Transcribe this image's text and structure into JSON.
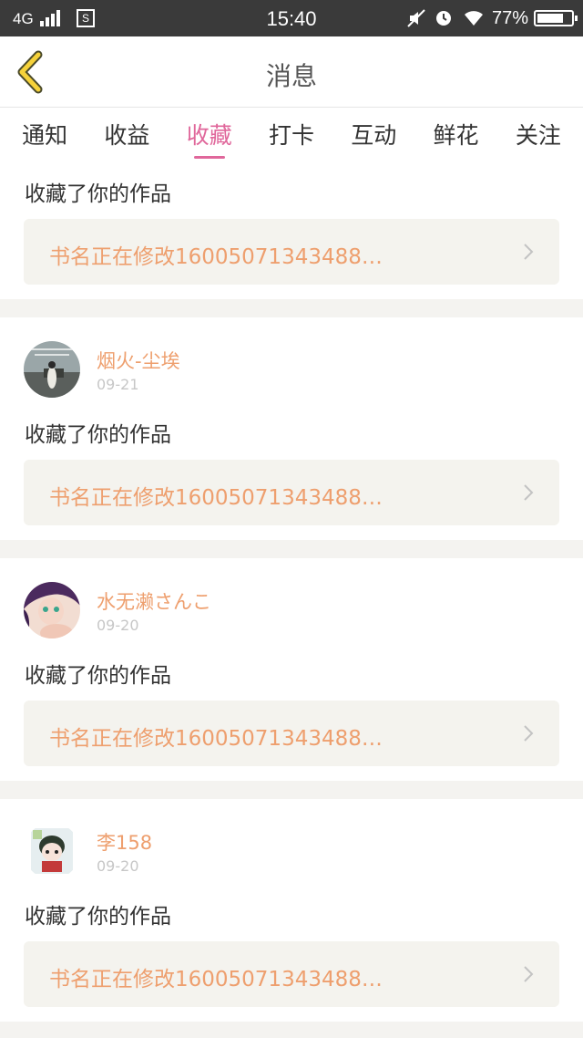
{
  "status_bar": {
    "network": "4G",
    "time": "15:40",
    "battery": "77%",
    "battery_level": 0.77,
    "icons": [
      "signal-icon",
      "sim-icon",
      "mute-icon",
      "alarm-icon",
      "wifi-icon",
      "battery-icon"
    ]
  },
  "header": {
    "title": "消息",
    "back_icon": "chevron-left-icon"
  },
  "colors": {
    "accent": "#e0679b",
    "name_orange": "#ee9f6e",
    "back_yellow": "#f6d23a"
  },
  "tabs": [
    {
      "label": "通知"
    },
    {
      "label": "收益"
    },
    {
      "label": "收藏",
      "active": true
    },
    {
      "label": "打卡"
    },
    {
      "label": "互动"
    },
    {
      "label": "鲜花"
    },
    {
      "label": "关注"
    }
  ],
  "messages": [
    {
      "user": "",
      "date": "",
      "action": "收藏了你的作品",
      "work_title": "书名正在修改16005071343488…"
    },
    {
      "user": "烟火-尘埃",
      "date": "09-21",
      "action": "收藏了你的作品",
      "work_title": "书名正在修改16005071343488…"
    },
    {
      "user": "水无濑さんこ",
      "date": "09-20",
      "action": "收藏了你的作品",
      "work_title": "书名正在修改16005071343488…"
    },
    {
      "user": "李158",
      "date": "09-20",
      "action": "收藏了你的作品",
      "work_title": "书名正在修改16005071343488…"
    }
  ]
}
